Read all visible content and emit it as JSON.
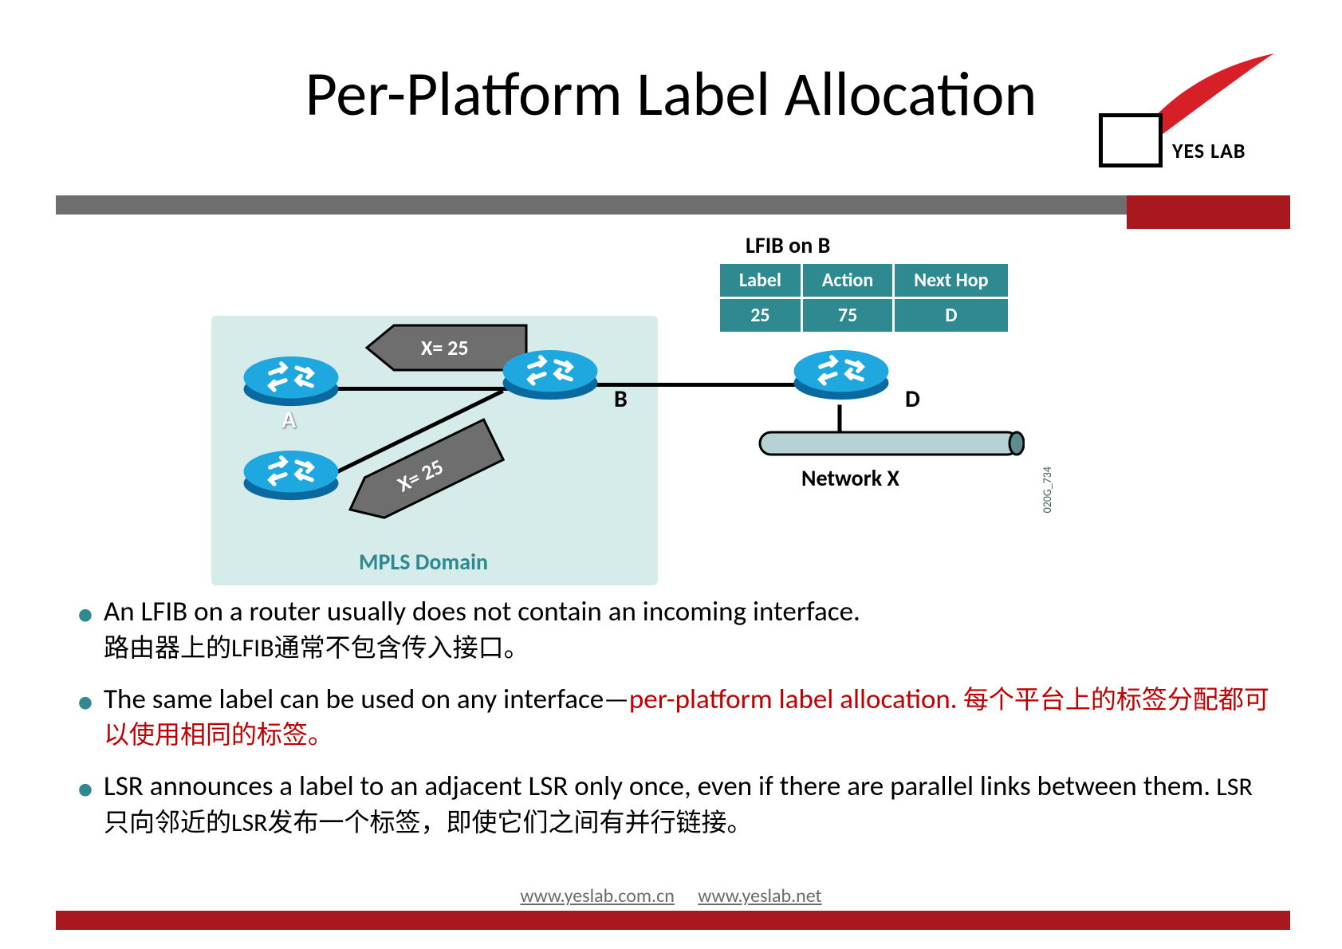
{
  "title": "Per-Platform Label Allocation",
  "logo": {
    "text": "YES LAB"
  },
  "diagram": {
    "mpls_domain_label": "MPLS Domain",
    "routers": {
      "A": {
        "label": "A"
      },
      "A2": {
        "label": ""
      },
      "B": {
        "label": "B"
      },
      "D": {
        "label": "D"
      }
    },
    "tag1": "X= 25",
    "tag2": "X= 25",
    "lfib_title": "LFIB on B",
    "lfib_headers": [
      "Label",
      "Action",
      "Next Hop"
    ],
    "lfib_row": [
      "25",
      "75",
      "D"
    ],
    "network_x": "Network X",
    "img_code": "020G_734"
  },
  "bullets": [
    {
      "en": "An LFIB on a router usually does not contain an incoming interface.",
      "cn": "路由器上的LFIB通常不包含传入接口。"
    },
    {
      "en_pre": "The same label can be used on any  interface—",
      "en_red": "per-platform label allocation.",
      "cn_red": "  每个平台上的标签分配都可以使用相同的标签。"
    },
    {
      "en": "LSR announces a label to an adjacent LSR only once, even if there  are parallel links between them.",
      "cn": "  LSR只向邻近的LSR发布一个标签，即使它们之间有并行链接。"
    }
  ],
  "footer": {
    "link1": "www.yeslab.com.cn",
    "link2": "www.yeslab.net"
  }
}
